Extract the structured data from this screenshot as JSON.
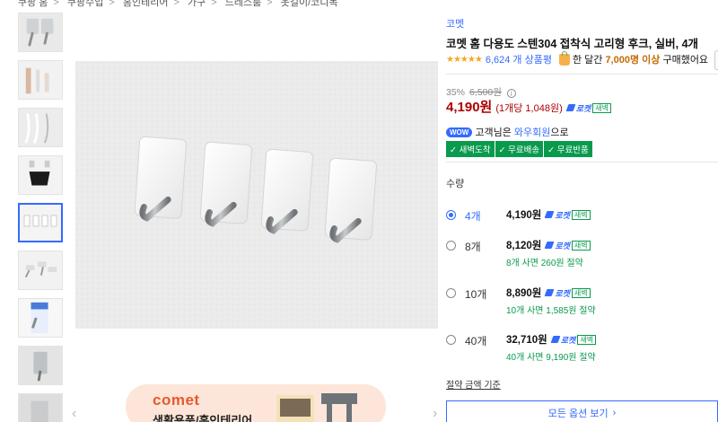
{
  "breadcrumb": [
    "쿠팡 홈",
    "쿠팡수입",
    "홈인테리어",
    "가구",
    "드레스룸",
    "옷걸이/코디목"
  ],
  "thumbnails": [
    {
      "name": "thumb-hooks-pair",
      "selected": false
    },
    {
      "name": "thumb-bathroom",
      "selected": false
    },
    {
      "name": "thumb-cables",
      "selected": false
    },
    {
      "name": "thumb-mask",
      "selected": false
    },
    {
      "name": "thumb-four-hooks",
      "selected": true
    },
    {
      "name": "thumb-hooks-scattered",
      "selected": false
    },
    {
      "name": "thumb-package",
      "selected": false
    },
    {
      "name": "thumb-single-hook",
      "selected": false
    },
    {
      "name": "thumb-more",
      "selected": false
    }
  ],
  "banner": {
    "brand": "comet",
    "subtitle": "생활용품/홈인테리어"
  },
  "product": {
    "brand_label": "코멧",
    "title": "코멧 홈 다용도 스텐304 접착식 고리형 후크, 실버, 4개",
    "stars": "★★★★★",
    "review_count": "6,624 개 상품평",
    "buy_prefix": "한 달간",
    "buy_highlight": "7,000명 이상",
    "buy_suffix": "구매했어요"
  },
  "pricing": {
    "discount_rate": "35%",
    "original_price": "6,500원",
    "sale_price": "4,190원",
    "unit_price": "(1개당 1,048원)",
    "rocket_label": "로켓",
    "new_label": "새벽"
  },
  "wow": {
    "badge": "WOW",
    "prefix": "고객님은",
    "link": "와우회원",
    "suffix": "으로"
  },
  "benefits": [
    "✓ 새벽도착",
    "✓ 무료배송",
    "✓ 무료반품"
  ],
  "quantity": {
    "label": "수량",
    "options": [
      {
        "qty": "4개",
        "price": "4,190원",
        "saving": "",
        "selected": true
      },
      {
        "qty": "8개",
        "price": "8,120원",
        "saving": "8개 사면 260원 절약",
        "selected": false
      },
      {
        "qty": "10개",
        "price": "8,890원",
        "saving": "10개 사면 1,585원 절약",
        "selected": false
      },
      {
        "qty": "40개",
        "price": "32,710원",
        "saving": "40개 사면 9,190원 절약",
        "selected": false
      }
    ]
  },
  "compare_link": "절약 금액 기준",
  "all_options_button": "모든 옵션 보기",
  "colors": {
    "accent_blue": "#346aff",
    "price_red": "#ae0000",
    "benefit_green": "#0a9a4e"
  }
}
